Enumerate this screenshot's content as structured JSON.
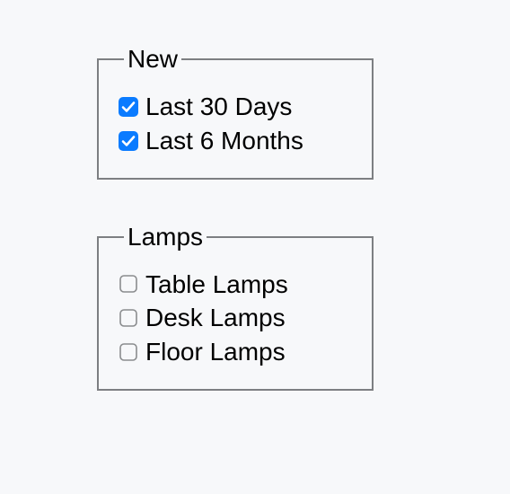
{
  "groups": [
    {
      "legend": "New",
      "options": [
        {
          "label": "Last 30 Days",
          "checked": true
        },
        {
          "label": "Last 6 Months",
          "checked": true
        }
      ]
    },
    {
      "legend": "Lamps",
      "options": [
        {
          "label": "Table Lamps",
          "checked": false
        },
        {
          "label": "Desk Lamps",
          "checked": false
        },
        {
          "label": "Floor Lamps",
          "checked": false
        }
      ]
    }
  ],
  "colors": {
    "checked_bg": "#0a7bff",
    "checked_fg": "#ffffff",
    "unchecked_border": "#8a8c8e"
  }
}
